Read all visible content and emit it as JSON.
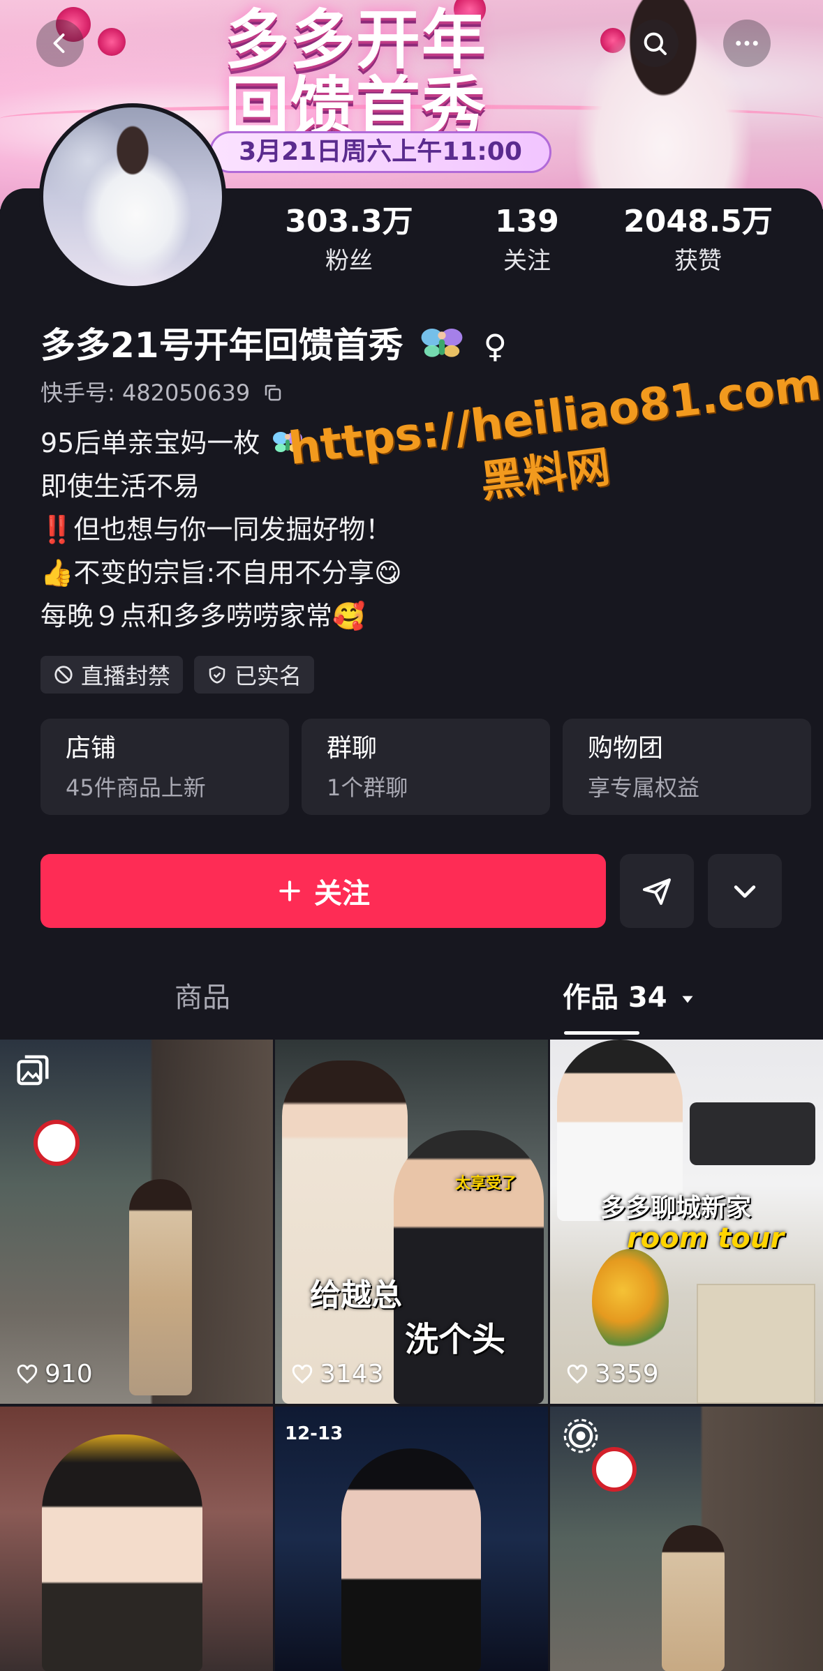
{
  "banner": {
    "title_line1": "多多开年",
    "title_line2": "回馈首秀",
    "date": "3月21日周六上午11:00"
  },
  "top_bar": {
    "back_icon": "chevron-left-icon",
    "search_icon": "search-icon",
    "more_icon": "more-horizontal-icon"
  },
  "stats": [
    {
      "value": "303.3万",
      "label": "粉丝"
    },
    {
      "value": "139",
      "label": "关注"
    },
    {
      "value": "2048.5万",
      "label": "获赞"
    }
  ],
  "profile": {
    "name": "多多21号开年回馈首秀",
    "gender_symbol": "♀",
    "uid": "快手号: 482050639",
    "bio": [
      "95后单亲宝妈一枚",
      "即使生活不易",
      "‼️但也想与你一同发掘好物！",
      "👍不变的宗旨:不自用不分享😋",
      "每晚９点和多多唠唠家常🥰"
    ]
  },
  "watermark": {
    "url": "https://heiliao81.com",
    "site": "黑料网"
  },
  "tags": [
    {
      "icon": "ban-icon",
      "label": "直播封禁"
    },
    {
      "icon": "shield-check-icon",
      "label": "已实名"
    }
  ],
  "entries": [
    {
      "title": "店铺",
      "subtitle": "45件商品上新"
    },
    {
      "title": "群聊",
      "subtitle": "1个群聊"
    },
    {
      "title": "购物团",
      "subtitle": "享专属权益"
    }
  ],
  "actions": {
    "follow_label": "关注",
    "share_icon": "send-icon",
    "expand_icon": "chevron-down-icon"
  },
  "tabs": [
    {
      "label": "商品"
    },
    {
      "label": "作品 34"
    }
  ],
  "works": [
    {
      "likes": "910",
      "captions": []
    },
    {
      "likes": "3143",
      "captions": [
        "太享受了",
        "给越总",
        "洗个头"
      ]
    },
    {
      "likes": "3359",
      "captions": [
        "多多聊城新家",
        "room tour"
      ]
    },
    {
      "likes": "",
      "captions": []
    },
    {
      "likes": "",
      "captions": [
        "12-13"
      ]
    },
    {
      "likes": "",
      "captions": []
    }
  ],
  "colors": {
    "accent": "#fe2c55",
    "background": "#17171f",
    "card": "#25252d",
    "watermark": "#f29a1e"
  }
}
